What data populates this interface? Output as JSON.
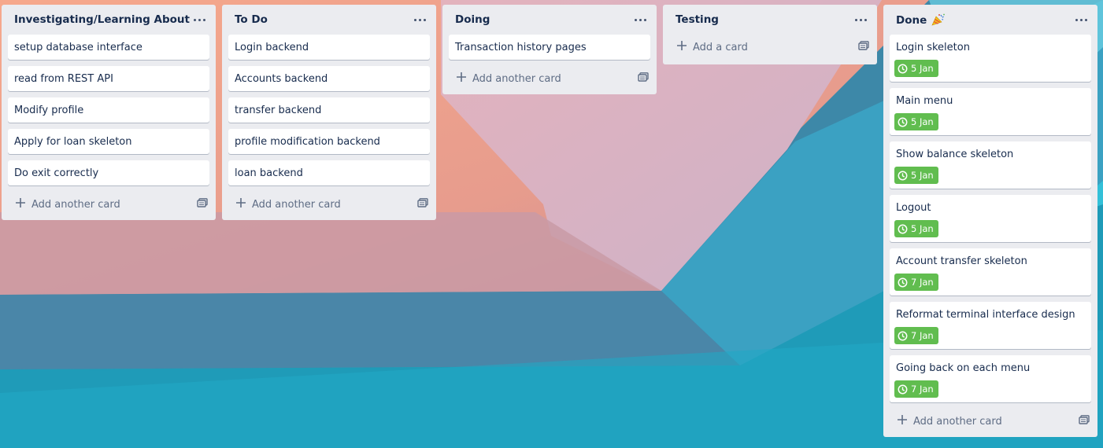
{
  "board": {
    "lists": [
      {
        "title": "Investigating/Learning About",
        "cards": [
          {
            "title": "setup database interface"
          },
          {
            "title": "read from REST API"
          },
          {
            "title": "Modify profile"
          },
          {
            "title": "Apply for loan skeleton"
          },
          {
            "title": "Do exit correctly"
          }
        ],
        "add_label": "Add another card"
      },
      {
        "title": "To Do",
        "cards": [
          {
            "title": "Login backend"
          },
          {
            "title": "Accounts backend"
          },
          {
            "title": "transfer backend"
          },
          {
            "title": "profile modification backend"
          },
          {
            "title": "loan backend"
          }
        ],
        "add_label": "Add another card"
      },
      {
        "title": "Doing",
        "cards": [
          {
            "title": "Transaction history pages"
          }
        ],
        "add_label": "Add another card"
      },
      {
        "title": "Testing",
        "cards": [],
        "add_label": "Add a card"
      },
      {
        "title": "Done",
        "title_icon": "party-popper-icon",
        "cards": [
          {
            "title": "Login skeleton",
            "due": "5 Jan"
          },
          {
            "title": "Main menu",
            "due": "5 Jan"
          },
          {
            "title": "Show balance skeleton",
            "due": "5 Jan"
          },
          {
            "title": "Logout",
            "due": "5 Jan"
          },
          {
            "title": "Account transfer skeleton",
            "due": "7 Jan"
          },
          {
            "title": "Reformat terminal interface design",
            "due": "7 Jan"
          },
          {
            "title": "Going back on each menu",
            "due": "7 Jan"
          }
        ],
        "add_label": "Add another card"
      }
    ]
  },
  "colors": {
    "list_bg": "#ebecf0",
    "card_bg": "#ffffff",
    "due_complete": "#61bd4f",
    "text": "#172b4d",
    "muted": "#5e6c84"
  }
}
